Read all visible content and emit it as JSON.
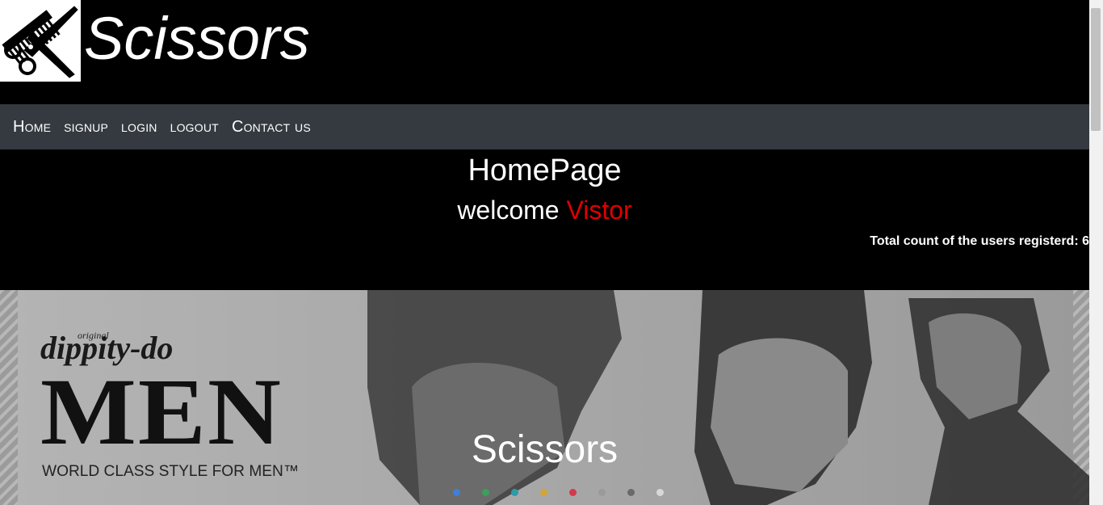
{
  "header": {
    "brand": "Scissors",
    "logo_icon": "comb-scissors-icon"
  },
  "nav": {
    "items": [
      {
        "label": "Home"
      },
      {
        "label": "signup"
      },
      {
        "label": "login"
      },
      {
        "label": "logout"
      },
      {
        "label": "Contact us"
      }
    ]
  },
  "hero": {
    "title": "HomePage",
    "welcome": "welcome",
    "visitor": "Vistor",
    "count_text": "Total count of the users registerd: 6"
  },
  "carousel": {
    "brand_small": "original",
    "brand_script": "dippity-do",
    "brand_big": "MEN",
    "tagline": "WORLD CLASS STYLE FOR MEN™",
    "caption": "Scissors",
    "indicators": [
      {
        "color": "#3f7fd6"
      },
      {
        "color": "#3aa05b"
      },
      {
        "color": "#2f9aa8"
      },
      {
        "color": "#d4a536"
      },
      {
        "color": "#d13a4a"
      },
      {
        "color": "#9a9a9a"
      },
      {
        "color": "#6a6a6a"
      },
      {
        "color": "#d8d8d8"
      }
    ]
  },
  "colors": {
    "nav_bg": "#343a40",
    "visitor": "#e00000"
  }
}
